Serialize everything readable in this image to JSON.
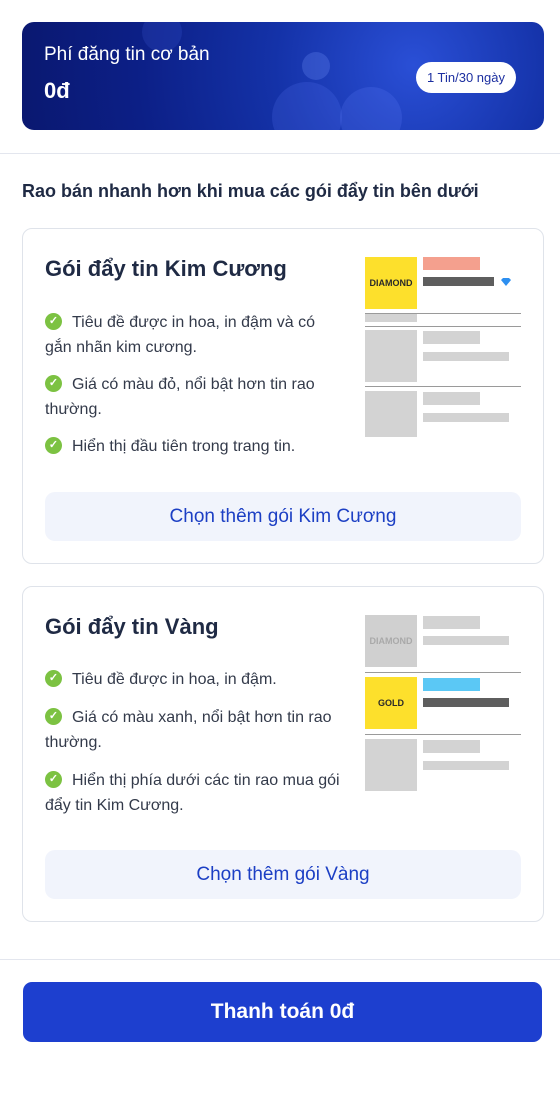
{
  "fee_card": {
    "title": "Phí đăng tin cơ bản",
    "amount": "0đ",
    "badge": "1 Tin/30 ngày"
  },
  "section_heading": "Rao bán nhanh hơn khi mua các gói đẩy tin bên dưới",
  "packages": [
    {
      "title": "Gói đẩy tin Kim Cương",
      "features": [
        "Tiêu đề được in hoa, in đậm và có gắn nhãn kim cương.",
        "Giá có màu đỏ, nổi bật hơn tin rao thường.",
        "Hiển thị đầu tiên trong trang tin."
      ],
      "button_label": "Chọn thêm gói Kim Cương",
      "preview_tag": "DIAMOND",
      "highlight_color": "#f4a08e"
    },
    {
      "title": "Gói đẩy tin Vàng",
      "features": [
        "Tiêu đề được in hoa, in đậm.",
        "Giá có màu xanh, nổi bật hơn tin rao thường.",
        "Hiển thị phía dưới các tin rao mua gói đẩy tin Kim Cương."
      ],
      "button_label": "Chọn thêm gói Vàng",
      "preview_tag_faded": "DIAMOND",
      "preview_tag": "GOLD",
      "highlight_color": "#5bc8f5"
    }
  ],
  "pay_button": "Thanh toán 0đ",
  "colors": {
    "primary": "#1d3fcf",
    "check": "#7cc242",
    "tag_yellow": "#fde02c"
  }
}
